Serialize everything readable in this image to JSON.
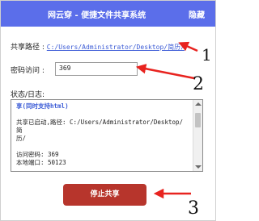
{
  "window": {
    "title": "网云穿 - 便捷文件共享系统",
    "hide_label": "隐藏"
  },
  "share": {
    "label": "共享路径 :",
    "path": "C:/Users/Administrator/Desktop/简历/"
  },
  "password": {
    "label": "密码访问 :",
    "value": "369"
  },
  "log": {
    "label": "状态/日志:",
    "line1": "享(同时支持html)",
    "line2": "共享已启动,路径: C:/Users/Administrator/Desktop/简",
    "line3": "历/",
    "line4": "访问密码: 369",
    "line5": "本地端口: 50123"
  },
  "actions": {
    "stop_label": "停止共享"
  },
  "annotations": {
    "arrow_color": "#e8231f",
    "marks": [
      "1",
      "2",
      "3"
    ]
  },
  "colors": {
    "titlebar": "#5b6eea",
    "stop_button": "#b7352c",
    "link": "#3b5bd6"
  }
}
